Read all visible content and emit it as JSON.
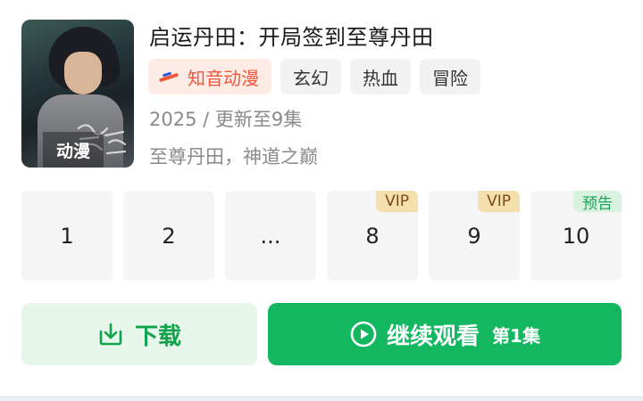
{
  "poster": {
    "tag": "动漫"
  },
  "show": {
    "title": "启运丹田：开局签到至尊丹田",
    "tags": {
      "brand": "知音动漫",
      "genre1": "玄幻",
      "genre2": "热血",
      "genre3": "冒险"
    },
    "meta": "2025 / 更新至9集",
    "tagline": "至尊丹田，神道之巅"
  },
  "episodes": [
    {
      "label": "1",
      "badge": ""
    },
    {
      "label": "2",
      "badge": ""
    },
    {
      "label": "...",
      "badge": ""
    },
    {
      "label": "8",
      "badge": "VIP"
    },
    {
      "label": "9",
      "badge": "VIP"
    },
    {
      "label": "10",
      "badge": "预告"
    }
  ],
  "actions": {
    "download": "下载",
    "continue": "继续观看",
    "continue_episode": "第1集"
  },
  "colors": {
    "accent_green": "#13b760",
    "vip_badge": "#f6dfae",
    "preview_badge": "#d8f2df",
    "brand_orange": "#f0573b"
  },
  "icons": {
    "download": "download-icon",
    "play": "play-circle-icon"
  }
}
